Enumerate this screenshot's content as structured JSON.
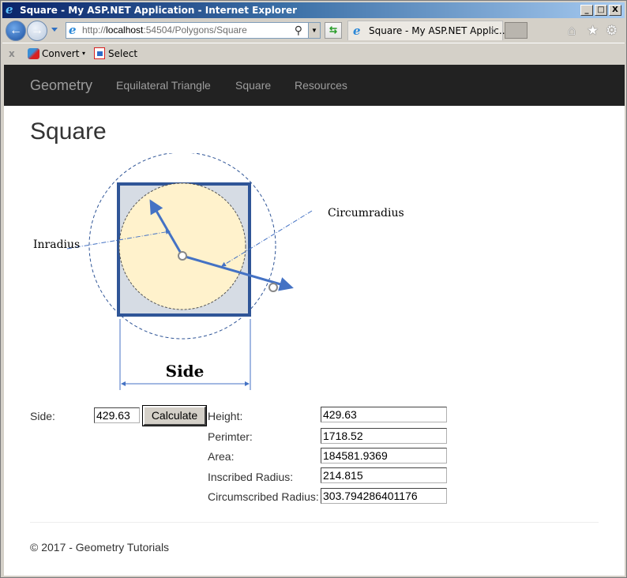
{
  "window": {
    "title": "Square - My ASP.NET Application - Internet Explorer",
    "buttons": {
      "minimize": "_",
      "maximize": "□",
      "close": "X"
    }
  },
  "browser": {
    "address": {
      "prefix": "http://",
      "host": "localhost",
      "rest": ":54504/Polygons/Square"
    },
    "tab_title": "Square - My ASP.NET Applic...",
    "tab_close": "×",
    "icons": [
      "back-icon",
      "forward-icon",
      "ie-icon",
      "search-icon",
      "refresh-icon",
      "home-icon",
      "star-icon",
      "gear-icon"
    ],
    "commands": {
      "close": "x",
      "convert": "Convert",
      "dropdown": "▾",
      "select": "Select"
    }
  },
  "navbar": {
    "brand": "Geometry",
    "links": [
      "Equilateral Triangle",
      "Square",
      "Resources"
    ]
  },
  "page": {
    "title": "Square",
    "diagram": {
      "labels": {
        "inradius": "Inradius",
        "circumradius": "Circumradius",
        "side": "Side"
      },
      "colors": {
        "square_fill": "#d6dce4",
        "square_stroke": "#2f5597",
        "incircle_fill": "#fff2cc",
        "arrow": "#4472c4"
      }
    },
    "form": {
      "side_label": "Side:",
      "side_value": "429.63",
      "calculate_label": "Calculate",
      "results": [
        {
          "label": "Height:",
          "value": "429.63"
        },
        {
          "label": "Perimter:",
          "value": "1718.52"
        },
        {
          "label": "Area:",
          "value": "184581.9369"
        },
        {
          "label": "Inscribed Radius:",
          "value": "214.815"
        },
        {
          "label": "Circumscribed Radius:",
          "value": "303.794286401176"
        }
      ]
    }
  },
  "footer": {
    "text": "© 2017 - Geometry Tutorials"
  }
}
